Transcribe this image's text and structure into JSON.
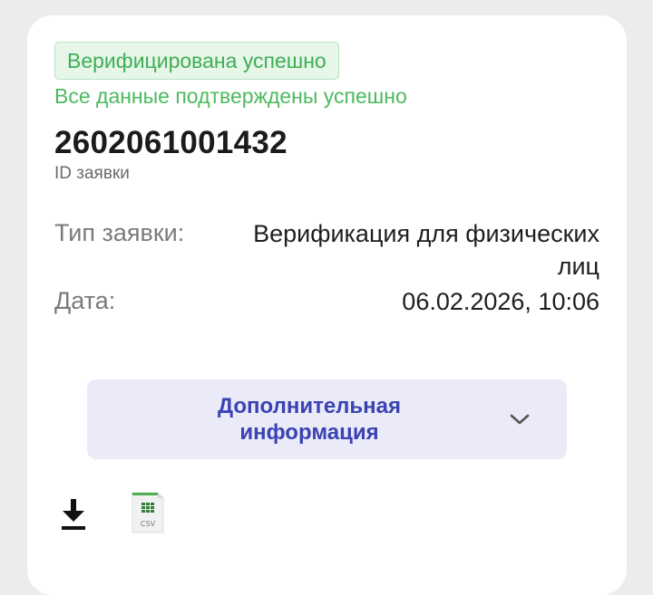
{
  "status": {
    "badge": "Верифицирована успешно",
    "message": "Все данные подтверждены успешно"
  },
  "request": {
    "id": "2602061001432",
    "id_label": "ID заявки"
  },
  "details": {
    "type_label": "Тип заявки:",
    "type_value": "Верификация для физических лиц",
    "date_label": "Дата:",
    "date_value": "06.02.2026, 10:06"
  },
  "more_info": {
    "label": "Дополнительная информация"
  },
  "actions": {
    "download_icon": "download-icon",
    "csv_icon": "csv-file-icon",
    "csv_text": "CSV"
  },
  "colors": {
    "success": "#4cba5f",
    "accent": "#3a43b3",
    "button_bg": "#eaeaf8"
  }
}
